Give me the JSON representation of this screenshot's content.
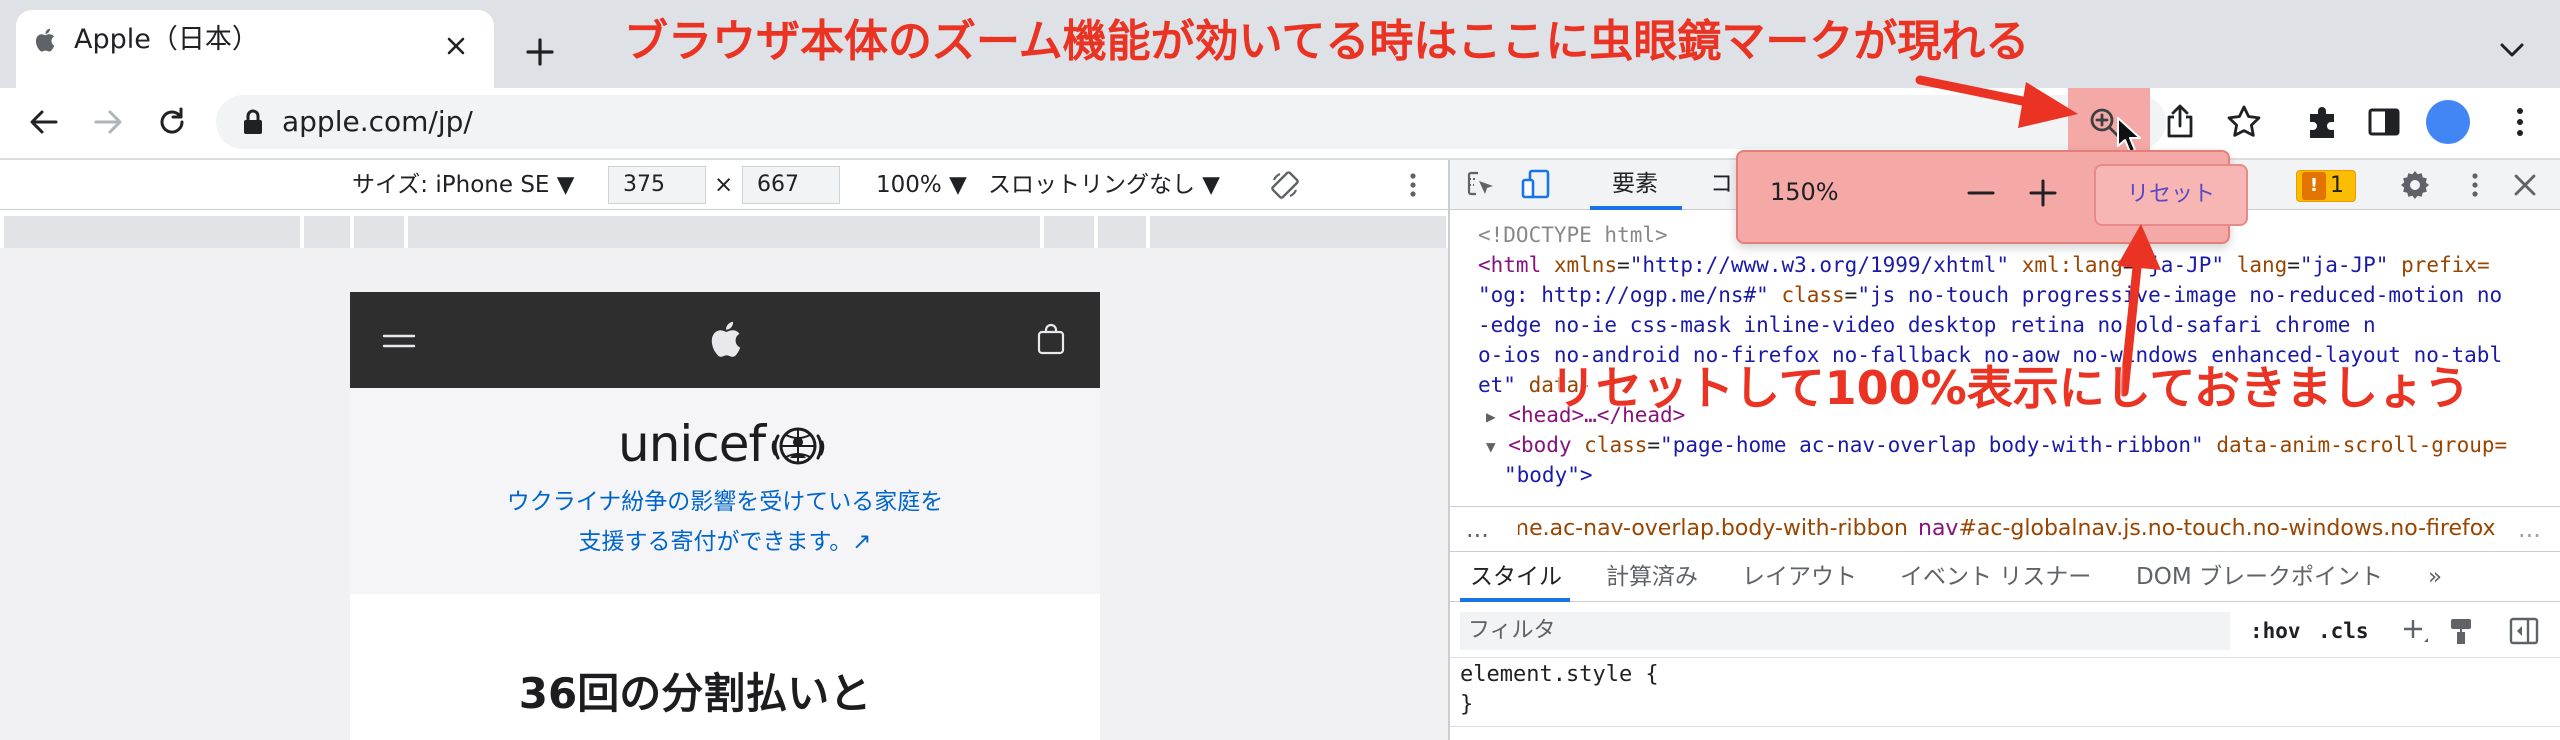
{
  "browser": {
    "tab_title": "Apple（日本）",
    "url": "apple.com/jp/"
  },
  "device_toolbar": {
    "size_label": "サイズ: iPhone SE ▼",
    "width": "375",
    "times": "×",
    "height": "667",
    "zoom": "100% ▼",
    "throttle": "スロットリングなし ▼"
  },
  "page": {
    "ribbon_brand": "unicef",
    "ribbon_line1": "ウクライナ紛争の影響を受けている家庭を",
    "ribbon_line2": "支援する寄付ができます。↗",
    "hero_text": "36回の分割払いと"
  },
  "devtools": {
    "tab_elements": "要素",
    "tab_cut": "コ",
    "issues_count": "1",
    "issues_mark": "!",
    "code": {
      "doctype": "<!DOCTYPE html>",
      "html_tag": "<html",
      "attr_xmlns": "xmlns",
      "val_xmlns": "\"http://www.w3.org/1999/xhtml\"",
      "attr_xmllang": "xml:lang",
      "val_xmllang": "\"ja-JP\"",
      "attr_lang": "lang",
      "val_lang": "\"ja-JP\"",
      "attr_prefix": "prefix=",
      "val_prefix": "\"og: http://ogp.me/ns#\"",
      "attr_class": "class",
      "val_class_l2": "\"js no-touch progressive-image no-reduced-motion no",
      "val_class_l3": "-edge no-ie css-mask inline-video desktop retina no-old-safari chrome n",
      "val_class_l4": "o-ios no-android no-firefox no-fallback no-aow no-windows enhanced-layout no-tabl",
      "val_class_l5": "et\"",
      "attr_data": "data-",
      "head_line": "<head>…</head>",
      "body_tag": "<body",
      "body_attr_class": "class",
      "body_val_class": "\"page-home ac-nav-overlap body-with-ribbon\"",
      "body_attr_anim": "data-anim-scroll-group=",
      "body_val_anim": "\"body\">"
    },
    "breadcrumb": {
      "dots": "...",
      "item1": "body.page-home.ac-nav-overlap.body-with-ribbon",
      "item2_tag": "nav",
      "item2_rest": "#ac-globalnav.js.no-touch.no-windows.no-firefox"
    },
    "styles_tabs": [
      "スタイル",
      "計算済み",
      "レイアウト",
      "イベント リスナー",
      "DOM ブレークポイント",
      "»"
    ],
    "filter_placeholder": "フィルタ",
    "hov": ":hov",
    "cls": ".cls",
    "element_style": "element.style {",
    "close_brace": "}"
  },
  "zoom_popup": {
    "level": "150%",
    "reset": "リセット"
  },
  "annotations": {
    "top": "ブラウザ本体のズーム機能が効いてる時はここに虫眼鏡マークが現れる",
    "bottom": "リセットして100%表示にしておきましょう",
    "color": "#ea3323"
  },
  "colors": {
    "accent": "#1a73e8",
    "highlight": "#f4a9a6",
    "link": "#0066cc",
    "tag": "#881280",
    "attr_name": "#994500",
    "attr_value": "#1a1aa6"
  }
}
